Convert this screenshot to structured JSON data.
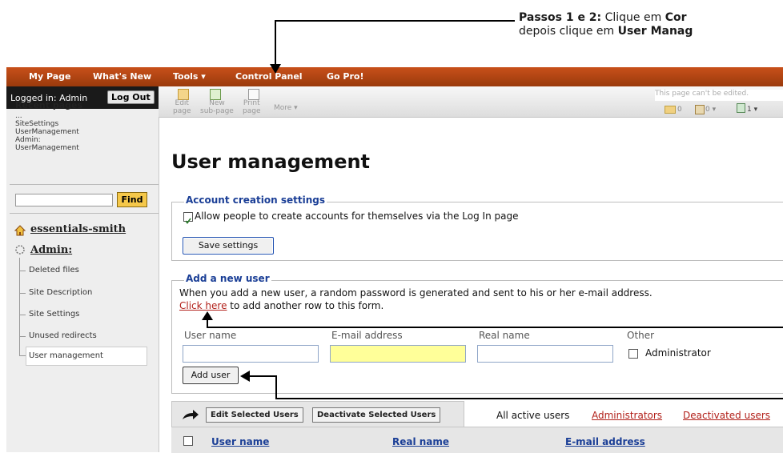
{
  "callout": {
    "line1_bold": "Passos 1 e 2:",
    "line1_text": " Clique em ",
    "line1_bold2": "Cor",
    "line2_text": "depois clique em ",
    "line2_bold": "User Manag"
  },
  "topnav": {
    "items": [
      "My Page",
      "What's New",
      "Tools ▾",
      "Control Panel",
      "Go Pro!"
    ]
  },
  "sidebar": {
    "logged_in": "Logged in: Admin",
    "logout": "Log Out",
    "recent_title": "Recent pages",
    "recent_items": [
      "...",
      "SiteSettings",
      "UserManagement",
      "Admin:",
      "UserManagement"
    ],
    "find_label": "Find",
    "site_link": "essentials-smith",
    "admin_link": "Admin:",
    "tree_items": [
      "Deleted files",
      "Site Description",
      "Site Settings",
      "Unused redirects",
      "User management"
    ]
  },
  "toolbar": {
    "edit": [
      "Edit",
      "page"
    ],
    "new": [
      "New",
      "sub-page"
    ],
    "print": [
      "Print",
      "page"
    ],
    "more": "More ▾",
    "cant_edit": "This page can't be edited.",
    "count_a": "0",
    "count_b": "0 ▾",
    "count_c": "1 ▾"
  },
  "main": {
    "title": "User management",
    "account": {
      "legend": "Account creation settings",
      "checkbox_label": "Allow people to create accounts for themselves via the Log In page",
      "save_button": "Save settings"
    },
    "add_user": {
      "legend": "Add a new user",
      "description": "When you add a new user, a random password is generated and sent to his or her e-mail address.",
      "click_here": "Click here",
      "click_here_suffix": " to add another row to this form.",
      "col_username": "User name",
      "col_email": "E-mail address",
      "col_realname": "Real name",
      "col_other": "Other",
      "admin_label": "Administrator",
      "add_button": "Add user"
    },
    "table": {
      "edit_selected": "Edit Selected Users",
      "deactivate_selected": "Deactivate Selected Users",
      "filter_all": "All active users",
      "filter_admins": "Administrators",
      "filter_deactivated": "Deactivated users",
      "header_username": "User name",
      "header_realname": "Real name",
      "header_email": "E-mail address"
    }
  },
  "colors": {
    "nav_orange": "#b8460f",
    "link_blue": "#1a3e96",
    "link_red": "#b2201a",
    "email_highlight": "#ffff99"
  }
}
